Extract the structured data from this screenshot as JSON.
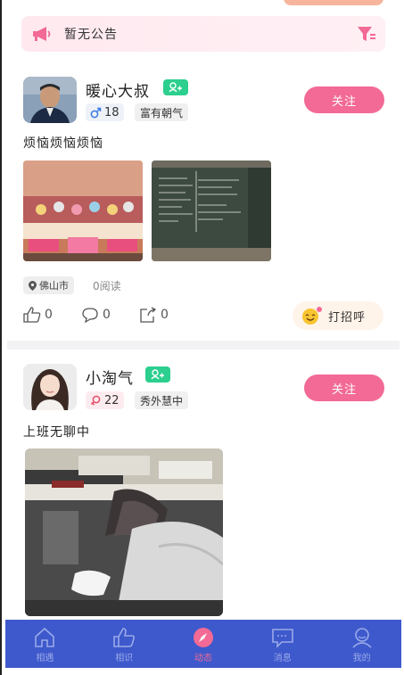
{
  "notice": {
    "text": "暂无公告",
    "icon": "megaphone-icon",
    "filter_icon": "filter-icon"
  },
  "posts": [
    {
      "name": "暖心大叔",
      "gender": "male",
      "age": "18",
      "trait": "富有朝气",
      "follow_label": "关注",
      "content": "烦恼烦恼烦恼",
      "location": "佛山市",
      "reads": "0阅读",
      "likes": "0",
      "comments": "0",
      "shares": "0",
      "greet_label": "打招呼"
    },
    {
      "name": "小淘气",
      "gender": "female",
      "age": "22",
      "trait": "秀外慧中",
      "follow_label": "关注",
      "content": "上班无聊中"
    }
  ],
  "tabs": [
    {
      "label": "相遇",
      "icon": "home-icon"
    },
    {
      "label": "相识",
      "icon": "thumbs-up-icon"
    },
    {
      "label": "动态",
      "icon": "compass-icon",
      "active": true
    },
    {
      "label": "消息",
      "icon": "message-icon"
    },
    {
      "label": "我的",
      "icon": "user-icon"
    }
  ],
  "colors": {
    "accent": "#f26a95",
    "tabbar": "#3e59cc",
    "vip": "#2ccf8e"
  }
}
